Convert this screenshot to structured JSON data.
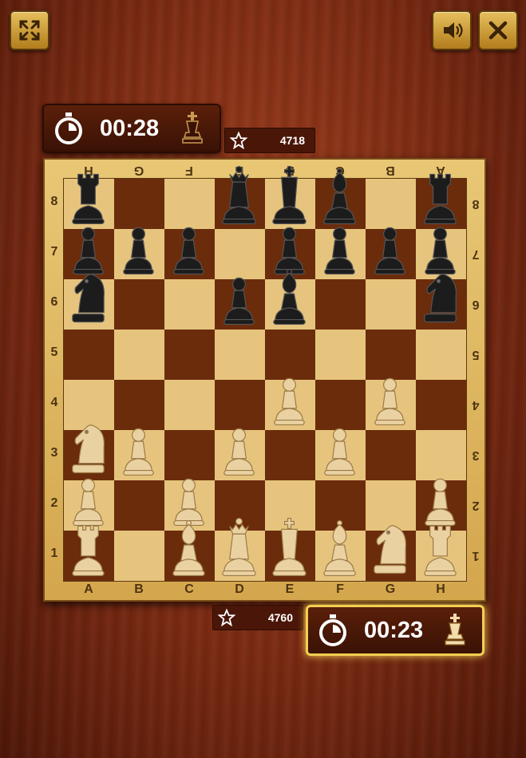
{
  "toolbar": {
    "fullscreen_icon": "fullscreen-icon",
    "sound_icon": "speaker-icon",
    "close_icon": "close-icon"
  },
  "opponent": {
    "time": "00:28",
    "score": "4718",
    "color": "black"
  },
  "player": {
    "time": "00:23",
    "score": "4760",
    "color": "white",
    "active": true
  },
  "board": {
    "files": [
      "A",
      "B",
      "C",
      "D",
      "E",
      "F",
      "G",
      "H"
    ],
    "ranks": [
      "8",
      "7",
      "6",
      "5",
      "4",
      "3",
      "2",
      "1"
    ],
    "top_files": [
      "H",
      "G",
      "F",
      "E",
      "D",
      "C",
      "B",
      "A"
    ],
    "pieces": [
      {
        "sq": "a8",
        "type": "rook",
        "color": "black"
      },
      {
        "sq": "d8",
        "type": "queen",
        "color": "black"
      },
      {
        "sq": "e8",
        "type": "king",
        "color": "black"
      },
      {
        "sq": "f8",
        "type": "bishop",
        "color": "black"
      },
      {
        "sq": "h8",
        "type": "rook",
        "color": "black"
      },
      {
        "sq": "a7",
        "type": "pawn",
        "color": "black"
      },
      {
        "sq": "b7",
        "type": "pawn",
        "color": "black"
      },
      {
        "sq": "c7",
        "type": "pawn",
        "color": "black"
      },
      {
        "sq": "e7",
        "type": "pawn",
        "color": "black"
      },
      {
        "sq": "f7",
        "type": "pawn",
        "color": "black"
      },
      {
        "sq": "g7",
        "type": "pawn",
        "color": "black"
      },
      {
        "sq": "h7",
        "type": "pawn",
        "color": "black"
      },
      {
        "sq": "a6",
        "type": "knight",
        "color": "black"
      },
      {
        "sq": "d6",
        "type": "pawn",
        "color": "black"
      },
      {
        "sq": "e6",
        "type": "bishop",
        "color": "black"
      },
      {
        "sq": "h6",
        "type": "knight",
        "color": "black"
      },
      {
        "sq": "e4",
        "type": "pawn",
        "color": "white"
      },
      {
        "sq": "g4",
        "type": "pawn",
        "color": "white"
      },
      {
        "sq": "a3",
        "type": "knight",
        "color": "white"
      },
      {
        "sq": "b3",
        "type": "pawn",
        "color": "white"
      },
      {
        "sq": "d3",
        "type": "pawn",
        "color": "white"
      },
      {
        "sq": "f3",
        "type": "pawn",
        "color": "white"
      },
      {
        "sq": "a2",
        "type": "pawn",
        "color": "white"
      },
      {
        "sq": "c2",
        "type": "pawn",
        "color": "white"
      },
      {
        "sq": "h2",
        "type": "pawn",
        "color": "white"
      },
      {
        "sq": "a1",
        "type": "rook",
        "color": "white"
      },
      {
        "sq": "c1",
        "type": "bishop",
        "color": "white"
      },
      {
        "sq": "d1",
        "type": "queen",
        "color": "white"
      },
      {
        "sq": "e1",
        "type": "king",
        "color": "white"
      },
      {
        "sq": "f1",
        "type": "bishop",
        "color": "white"
      },
      {
        "sq": "g1",
        "type": "knight",
        "color": "white"
      },
      {
        "sq": "h1",
        "type": "rook",
        "color": "white"
      }
    ]
  },
  "colors": {
    "light_square": "#e6c47d",
    "dark_square": "#6b2c0c",
    "highlight": "#f2cf52"
  }
}
